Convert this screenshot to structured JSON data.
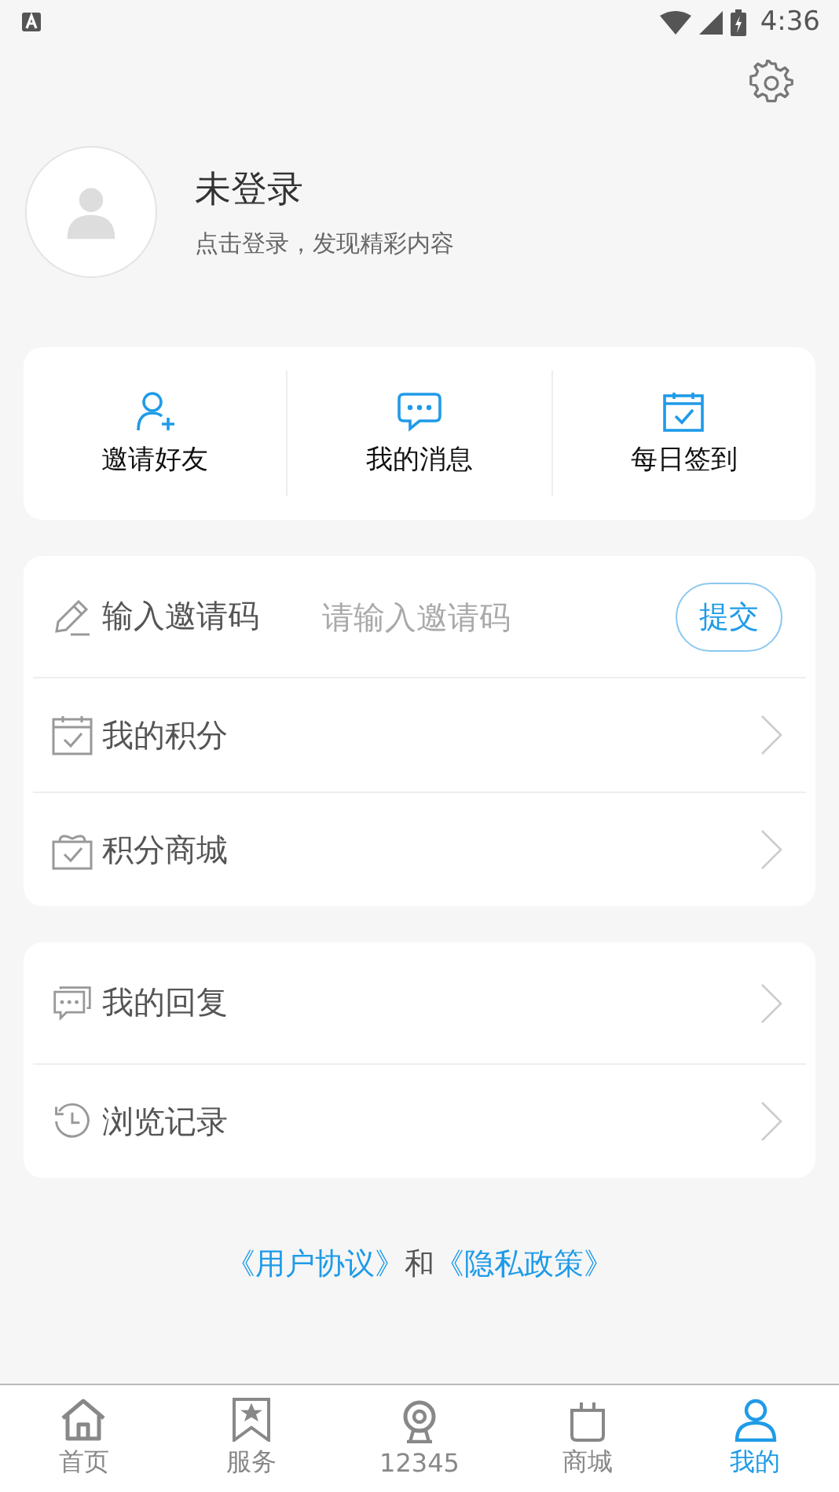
{
  "status_bar": {
    "time": "4:36"
  },
  "profile": {
    "name": "未登录",
    "hint": "点击登录，发现精彩内容"
  },
  "quick_actions": [
    {
      "kind": "invite",
      "label": "邀请好友"
    },
    {
      "kind": "message",
      "label": "我的消息"
    },
    {
      "kind": "checkin",
      "label": "每日签到"
    }
  ],
  "invite_code": {
    "label": "输入邀请码",
    "placeholder": "请输入邀请码",
    "button": "提交"
  },
  "menu_groups": [
    [
      {
        "kind": "points",
        "label": "我的积分"
      },
      {
        "kind": "mall",
        "label": "积分商城"
      }
    ],
    [
      {
        "kind": "reply",
        "label": "我的回复"
      },
      {
        "kind": "history",
        "label": "浏览记录"
      }
    ]
  ],
  "footer": {
    "link_1": "《用户协议》",
    "joiner": "和",
    "link_2": "《隐私政策》"
  },
  "tabs": [
    {
      "kind": "home",
      "label": "首页",
      "selected": false
    },
    {
      "kind": "service",
      "label": "服务",
      "selected": false
    },
    {
      "kind": "camera",
      "label": "12345",
      "selected": false
    },
    {
      "kind": "mall",
      "label": "商城",
      "selected": false
    },
    {
      "kind": "me",
      "label": "我的",
      "selected": true
    }
  ]
}
